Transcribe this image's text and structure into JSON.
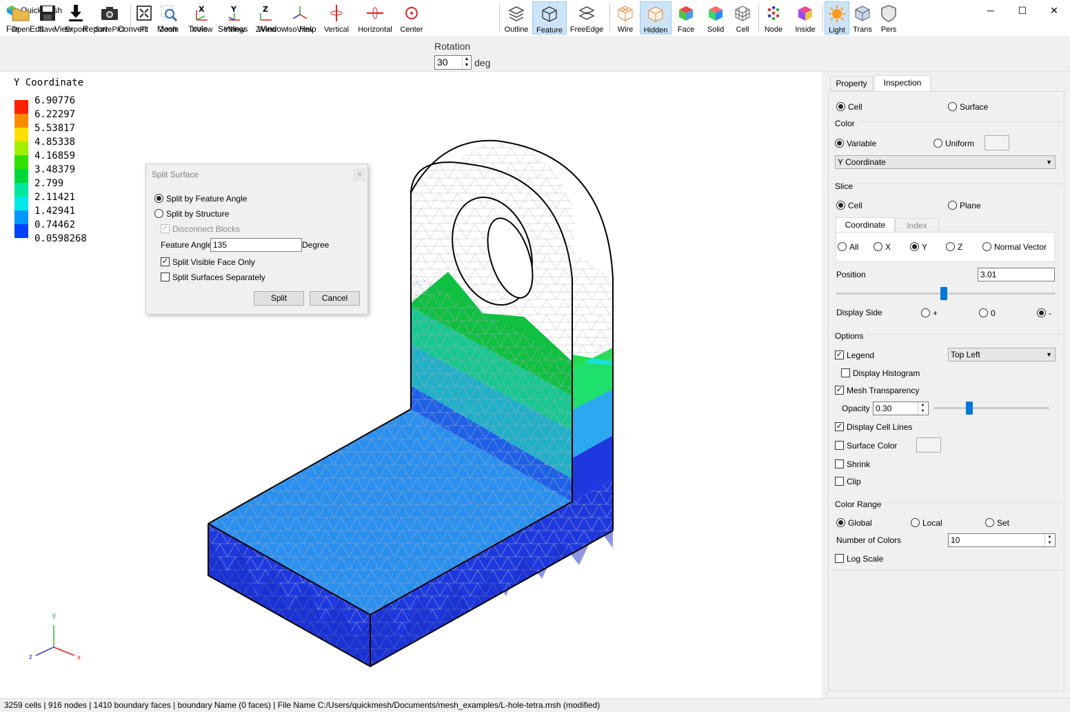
{
  "app": {
    "title": "QuickMesh",
    "min": "─",
    "max": "☐",
    "close": "✕"
  },
  "menu": [
    "File",
    "Edit",
    "View",
    "Report",
    "Convert",
    "Mesh",
    "Tools",
    "Settings",
    "Window",
    "Help"
  ],
  "toolbar": {
    "open": "Open",
    "save": "Save",
    "export": "Export",
    "savepict": "SavePict",
    "fit": "Fit",
    "zoom": "Zoom",
    "xview": "XView",
    "yview": "YView",
    "zview": "ZView",
    "isoview": "IsoView",
    "vertical": "Vertical",
    "horizontal": "Horizontal",
    "center": "Center",
    "rotation_label": "Rotation",
    "rotation_value": "30",
    "rotation_unit": "deg",
    "outline": "Outline",
    "feature": "Feature",
    "freeedge": "FreeEdge",
    "wire": "Wire",
    "hidden": "Hidden",
    "face": "Face",
    "solid": "Solid",
    "cell": "Cell",
    "node": "Node",
    "inside": "Inside",
    "light": "Light",
    "trans": "Trans",
    "pers": "Pers"
  },
  "legend": {
    "title": "Y Coordinate",
    "entries": [
      {
        "label": "6.90776",
        "color": "#ff2000"
      },
      {
        "label": "6.22297",
        "color": "#ff8c00"
      },
      {
        "label": "5.53817",
        "color": "#ffe000"
      },
      {
        "label": "4.85338",
        "color": "#a0f000"
      },
      {
        "label": "4.16859",
        "color": "#30e000"
      },
      {
        "label": "3.48379",
        "color": "#00d838"
      },
      {
        "label": "2.799",
        "color": "#00e8a0"
      },
      {
        "label": "2.11421",
        "color": "#00e8e8"
      },
      {
        "label": "1.42941",
        "color": "#0096ff"
      },
      {
        "label": "0.74462",
        "color": "#0040ff"
      },
      {
        "label": "0.0598268",
        "color": ""
      }
    ]
  },
  "dialog": {
    "title": "Split Surface",
    "close": "✕",
    "opt_feature": "Split by Feature Angle",
    "opt_structure": "Split by Structure",
    "disconnect": "Disconnect Blocks",
    "feature_angle_label": "Feature Angle",
    "feature_angle_value": "135",
    "degree": "Degree",
    "visible_only": "Split Visible Face Only",
    "separately": "Split Surfaces Separately",
    "split": "Split",
    "cancel": "Cancel"
  },
  "panel": {
    "tab_property": "Property",
    "tab_inspection": "Inspection",
    "cell": "Cell",
    "surface": "Surface",
    "color_group": "Color",
    "variable": "Variable",
    "uniform": "Uniform",
    "variable_select": "Y Coordinate",
    "slice_group": "Slice",
    "slice_cell": "Cell",
    "slice_plane": "Plane",
    "subtab_coordinate": "Coordinate",
    "subtab_index": "Index",
    "axis_all": "All",
    "axis_x": "X",
    "axis_y": "Y",
    "axis_z": "Z",
    "axis_normal": "Normal Vector",
    "position_label": "Position",
    "position_value": "3.01",
    "position_fraction": 0.49,
    "display_side": "Display Side",
    "side_plus": "+",
    "side_zero": "0",
    "side_minus": "-",
    "options_group": "Options",
    "legend": "Legend",
    "legend_pos": "Top Left",
    "histogram": "Display Histogram",
    "mesh_transparency": "Mesh Transparency",
    "opacity_label": "Opacity",
    "opacity_value": "0.30",
    "opacity_fraction": 0.3,
    "cell_lines": "Display Cell Lines",
    "surface_color": "Surface Color",
    "shrink": "Shrink",
    "clip": "Clip",
    "range_group": "Color Range",
    "global": "Global",
    "local": "Local",
    "set": "Set",
    "num_colors_label": "Number of Colors",
    "num_colors_value": "10",
    "log_scale": "Log Scale"
  },
  "axes": {
    "y": "y",
    "z": "z",
    "x": "x"
  },
  "status": "3259 cells | 916 nodes | 1410 boundary faces |  boundary Name  (0 faces) | File Name C:/Users/quickmesh/Documents/mesh_examples/L-hole-tetra.msh (modified)"
}
